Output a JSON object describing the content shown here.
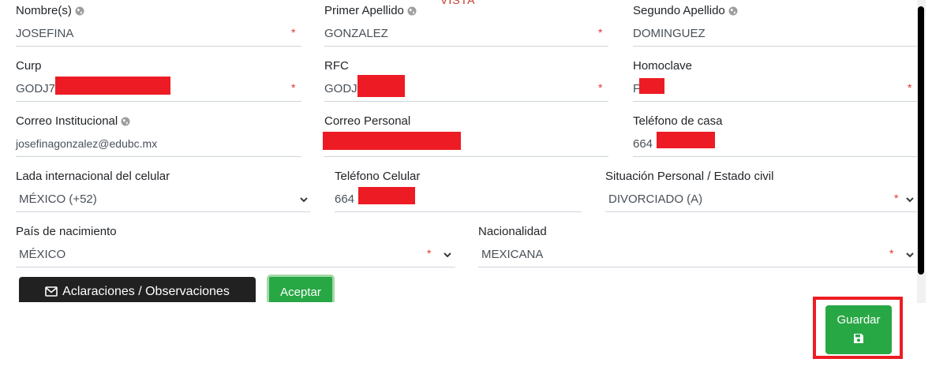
{
  "form": {
    "top_fragment": "VISTA",
    "fields": {
      "nombres": {
        "label": "Nombre(s)",
        "value": "JOSEFINA"
      },
      "primer_apellido": {
        "label": "Primer Apellido",
        "value": "GONZALEZ"
      },
      "segundo_apellido": {
        "label": "Segundo Apellido",
        "value": "DOMINGUEZ"
      },
      "curp": {
        "label": "Curp",
        "value": "GODJ7"
      },
      "rfc": {
        "label": "RFC",
        "value": "GODJ"
      },
      "homoclave": {
        "label": "Homoclave",
        "value": "F"
      },
      "correo_institucional": {
        "label": "Correo Institucional",
        "value": "josefinagonzalez@edubc.mx"
      },
      "correo_personal": {
        "label": "Correo Personal",
        "value": ""
      },
      "telefono_casa": {
        "label": "Teléfono de casa",
        "value": "664"
      },
      "lada": {
        "label": "Lada internacional del celular",
        "value": "MÉXICO (+52)"
      },
      "telefono_celular": {
        "label": "Teléfono Celular",
        "value": "664"
      },
      "estado_civil": {
        "label": "Situación Personal / Estado civil",
        "value": "DIVORCIADO (A)"
      },
      "pais_nacimiento": {
        "label": "País de nacimiento",
        "value": "MÉXICO"
      },
      "nacionalidad": {
        "label": "Nacionalidad",
        "value": "MEXICANA"
      }
    },
    "required_marker": "*",
    "buttons": {
      "observaciones": "Aclaraciones / Observaciones",
      "aceptar": "Aceptar",
      "guardar": "Guardar"
    }
  },
  "icons": {
    "globe": "globe-icon",
    "chevron": "chevron-down-icon",
    "envelope": "envelope-icon",
    "save": "floppy-disk-icon"
  },
  "colors": {
    "required": "#e3342f",
    "redaction": "#ed1c24",
    "success": "#28a745",
    "dark": "#212121",
    "highlight": "#ed1c24"
  }
}
